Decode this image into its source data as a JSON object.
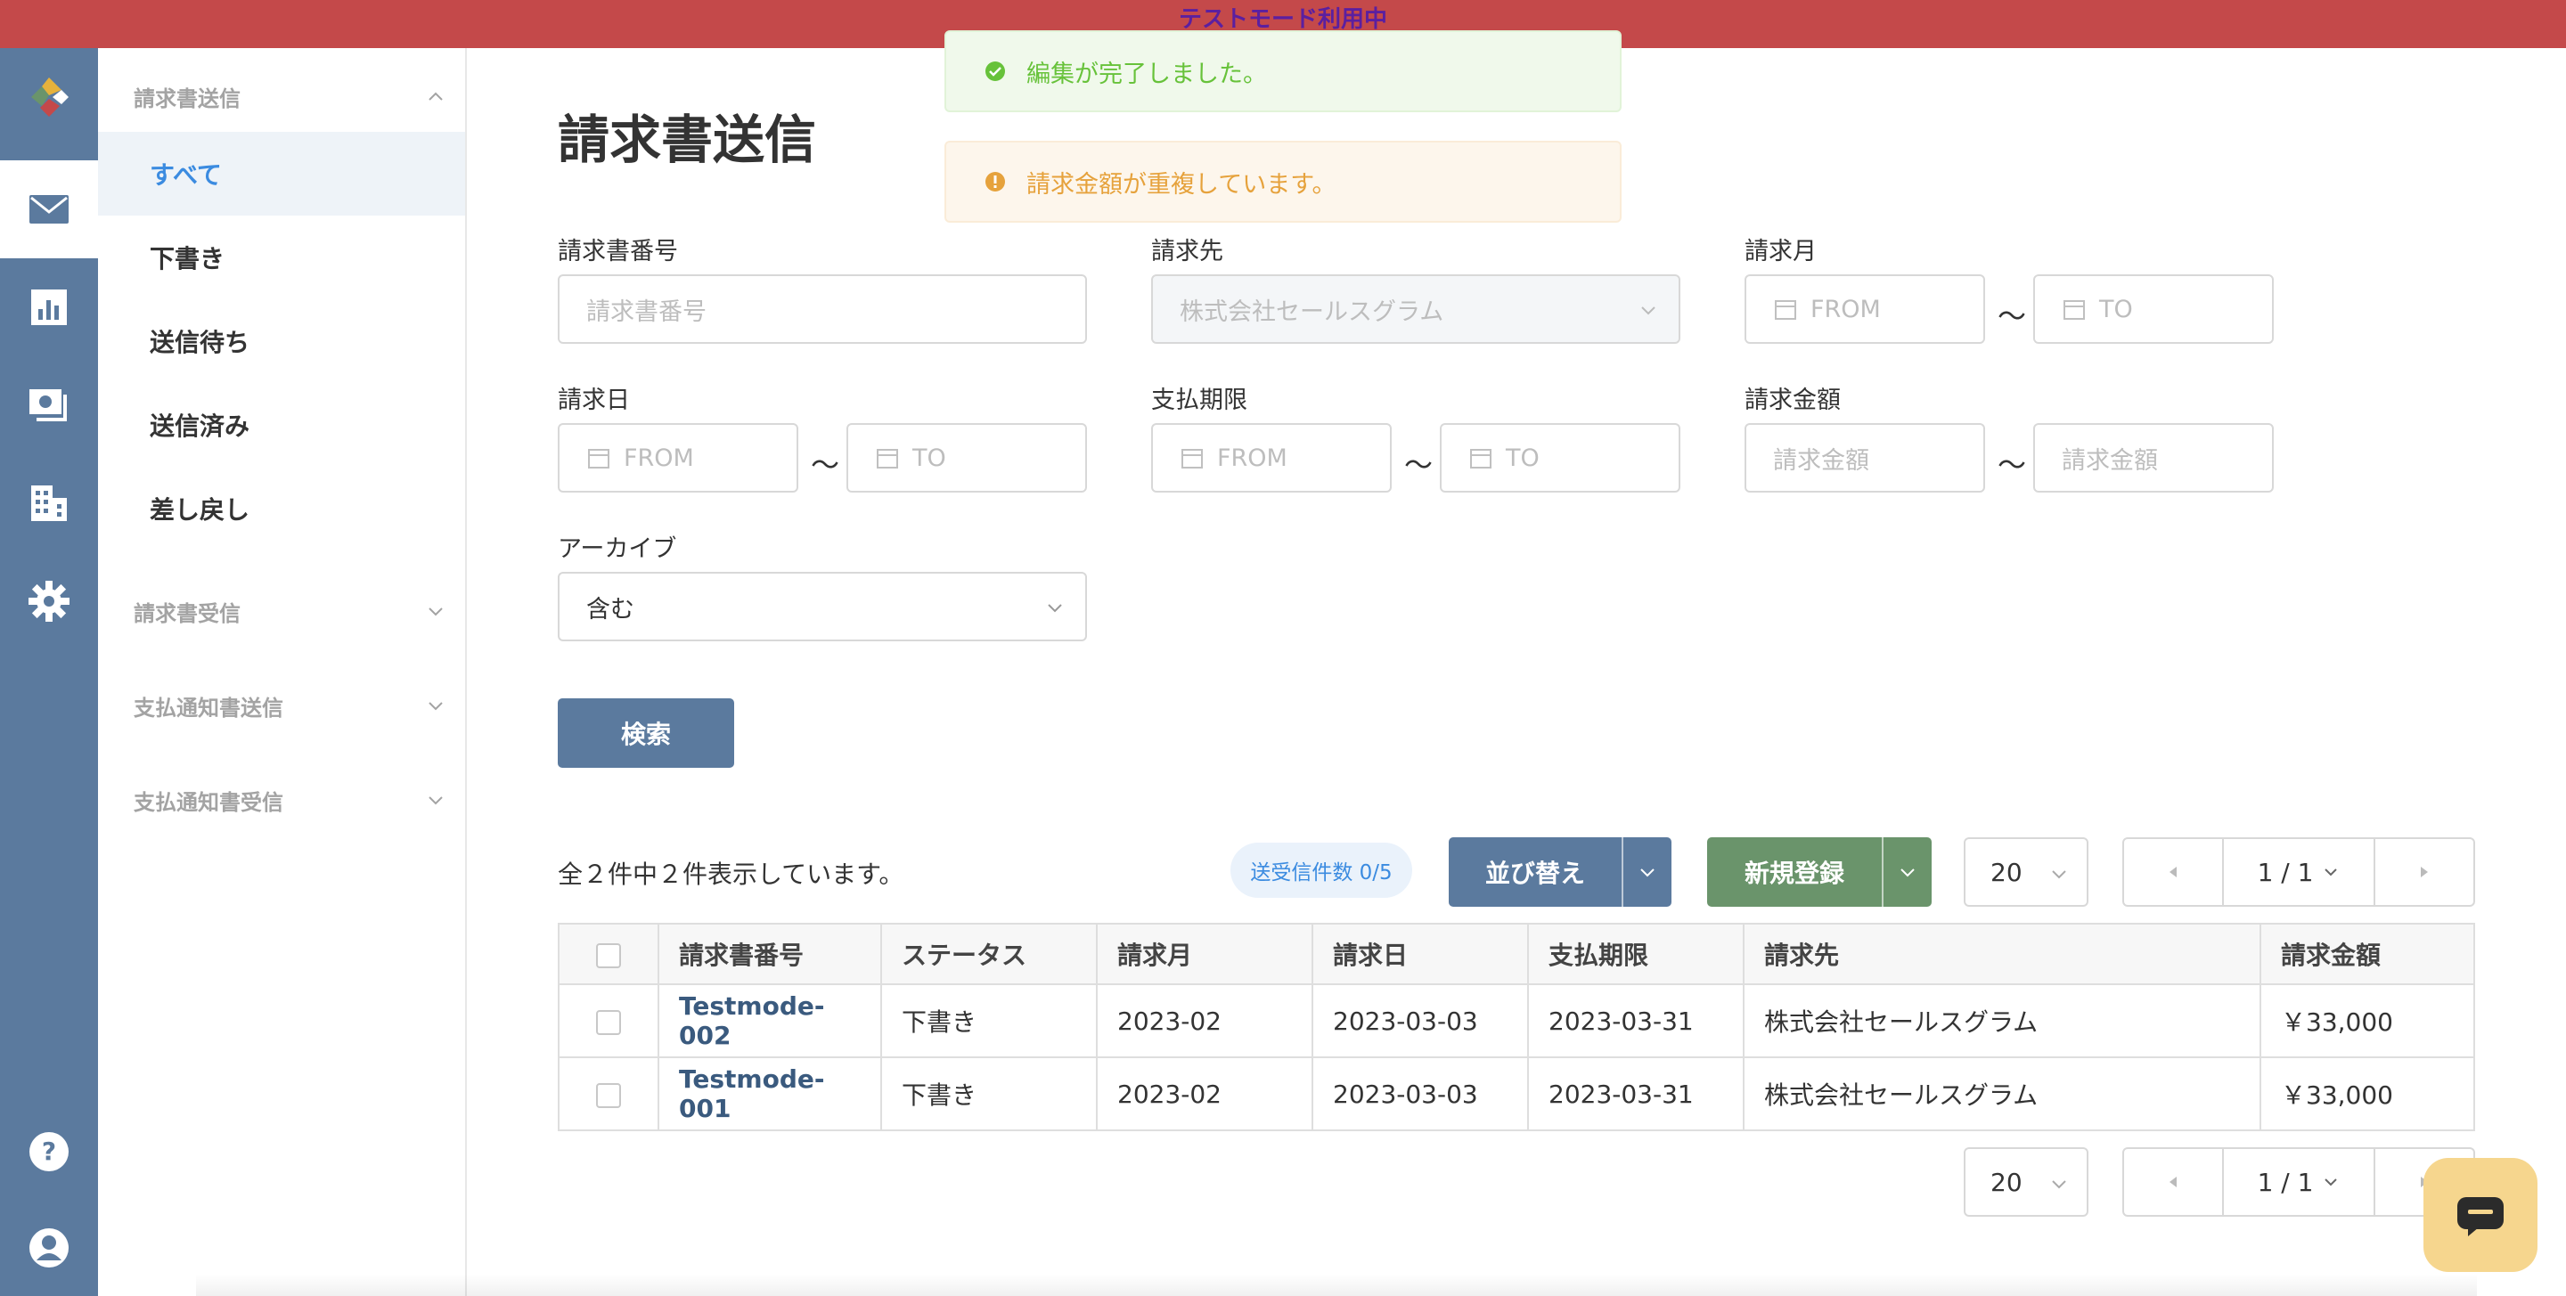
{
  "banner": {
    "text": "テストモード利用中"
  },
  "colors": {
    "banner": "#c4494a",
    "rail": "#5b7a9e",
    "accent": "#3b8be0",
    "primary_button": "#5b7a9e",
    "create_button": "#6a946b",
    "success": "#67c23a",
    "warning": "#e6a23c"
  },
  "rail": {
    "icons": [
      "logo-icon",
      "mail-icon",
      "chart-icon",
      "payment-icon",
      "building-icon",
      "gear-icon",
      "help-icon",
      "user-icon"
    ],
    "active": "mail-icon"
  },
  "sidebar": {
    "sections": [
      {
        "title": "請求書送信",
        "expanded": true,
        "items": [
          "すべて",
          "下書き",
          "送信待ち",
          "送信済み",
          "差し戻し"
        ],
        "active_item": "すべて"
      },
      {
        "title": "請求書受信",
        "expanded": false
      },
      {
        "title": "支払通知書送信",
        "expanded": false
      },
      {
        "title": "支払通知書受信",
        "expanded": false
      }
    ]
  },
  "page": {
    "title": "請求書送信"
  },
  "toasts": {
    "success": "編集が完了しました。",
    "warning": "請求金額が重複しています。"
  },
  "filters": {
    "invoice_number": {
      "label": "請求書番号",
      "placeholder": "請求書番号"
    },
    "billing_to": {
      "label": "請求先",
      "value": "株式会社セールスグラム"
    },
    "billing_month": {
      "label": "請求月",
      "from": "FROM",
      "to": "TO"
    },
    "invoice_date": {
      "label": "請求日",
      "from": "FROM",
      "to": "TO"
    },
    "due_date": {
      "label": "支払期限",
      "from": "FROM",
      "to": "TO"
    },
    "amount": {
      "label": "請求金額",
      "from_placeholder": "請求金額",
      "to_placeholder": "請求金額"
    },
    "archive": {
      "label": "アーカイブ",
      "value": "含む"
    },
    "range_separator": "〜",
    "search_button": "検索"
  },
  "results": {
    "summary": "全２件中２件表示しています。",
    "send_count_badge": "送受信件数 0/5",
    "sort_button": "並び替え",
    "create_button": "新規登録",
    "per_page": "20",
    "page_indicator": "1 / 1"
  },
  "table": {
    "headers": [
      "請求書番号",
      "ステータス",
      "請求月",
      "請求日",
      "支払期限",
      "請求先",
      "請求金額"
    ],
    "rows": [
      {
        "number": "Testmode-002",
        "status": "下書き",
        "month": "2023-02",
        "date": "2023-03-03",
        "due": "2023-03-31",
        "client": "株式会社セールスグラム",
        "amount": "￥33,000"
      },
      {
        "number": "Testmode-001",
        "status": "下書き",
        "month": "2023-02",
        "date": "2023-03-03",
        "due": "2023-03-31",
        "client": "株式会社セールスグラム",
        "amount": "￥33,000"
      }
    ]
  }
}
